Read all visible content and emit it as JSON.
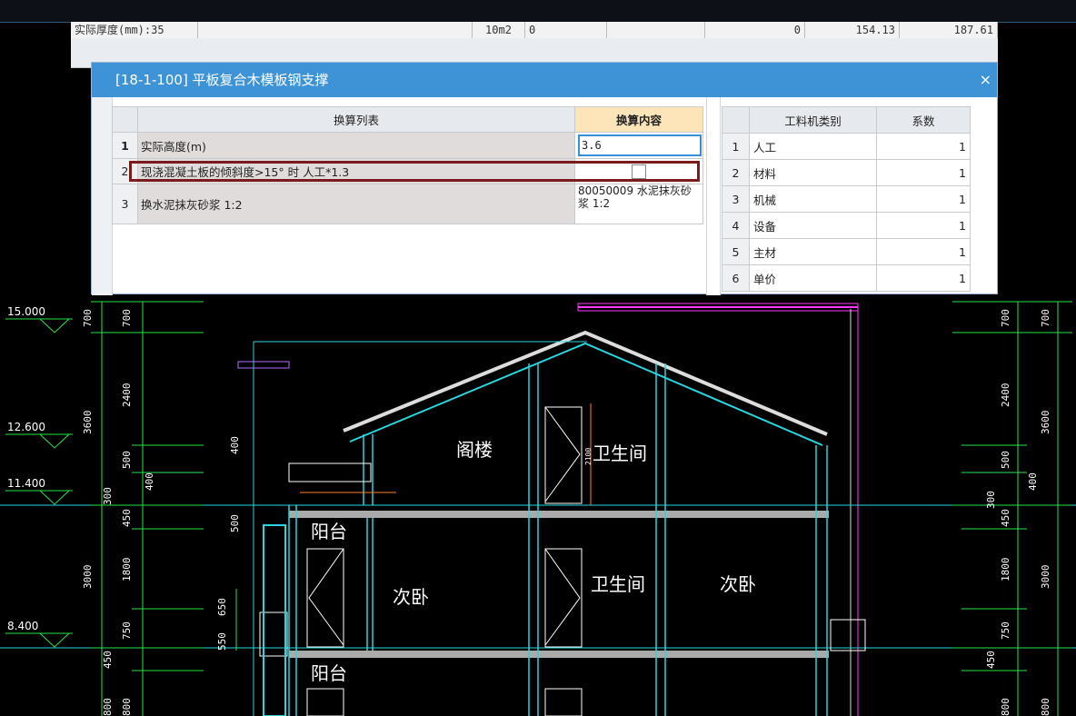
{
  "background_table": {
    "cells": [
      "实际厚度(mm):35",
      "10m2",
      "0",
      "0",
      "154.13",
      "187.61"
    ]
  },
  "dialog": {
    "title": "[18-1-100] 平板复合木模板钢支撑",
    "close_icon": "×",
    "left_table": {
      "headers": [
        "换算列表",
        "换算内容"
      ],
      "rows": [
        {
          "num": "1",
          "name": "实际高度(m)",
          "value": "3.6"
        },
        {
          "num": "2",
          "name": "现浇混凝土板的倾斜度>15° 时 人工*1.3",
          "value": ""
        },
        {
          "num": "3",
          "name": "换水泥抹灰砂浆 1:2",
          "value": "80050009  水泥抹灰砂浆 1:2"
        }
      ]
    },
    "right_table": {
      "headers": [
        "工料机类别",
        "系数"
      ],
      "rows": [
        {
          "num": "1",
          "category": "人工",
          "coef": "1"
        },
        {
          "num": "2",
          "category": "材料",
          "coef": "1"
        },
        {
          "num": "3",
          "category": "机械",
          "coef": "1"
        },
        {
          "num": "4",
          "category": "设备",
          "coef": "1"
        },
        {
          "num": "5",
          "category": "主材",
          "coef": "1"
        },
        {
          "num": "6",
          "category": "单价",
          "coef": "1"
        }
      ]
    }
  },
  "drawing": {
    "rooms": {
      "attic": "阁楼",
      "bath_top": "卫生间",
      "balcony_1": "阳台",
      "bedroom_left": "次卧",
      "bath_mid": "卫生间",
      "bedroom_right": "次卧",
      "balcony_2": "阳台"
    },
    "elevations": [
      "15.000",
      "12.600",
      "11.400",
      "8.400"
    ],
    "left_dims_outer": [
      "3600",
      "3000"
    ],
    "left_dims_inner": [
      "700",
      "2400",
      "500",
      "450",
      "1800",
      "750",
      "450",
      "800"
    ],
    "left_dims_misc": [
      "400",
      "300",
      "400",
      "500",
      "650",
      "550",
      "2100"
    ],
    "right_dims_inner": [
      "700",
      "2400",
      "500",
      "300",
      "450",
      "1800",
      "750",
      "450",
      "800"
    ],
    "right_dims_outer": [
      "3600",
      "400",
      "3000"
    ]
  }
}
